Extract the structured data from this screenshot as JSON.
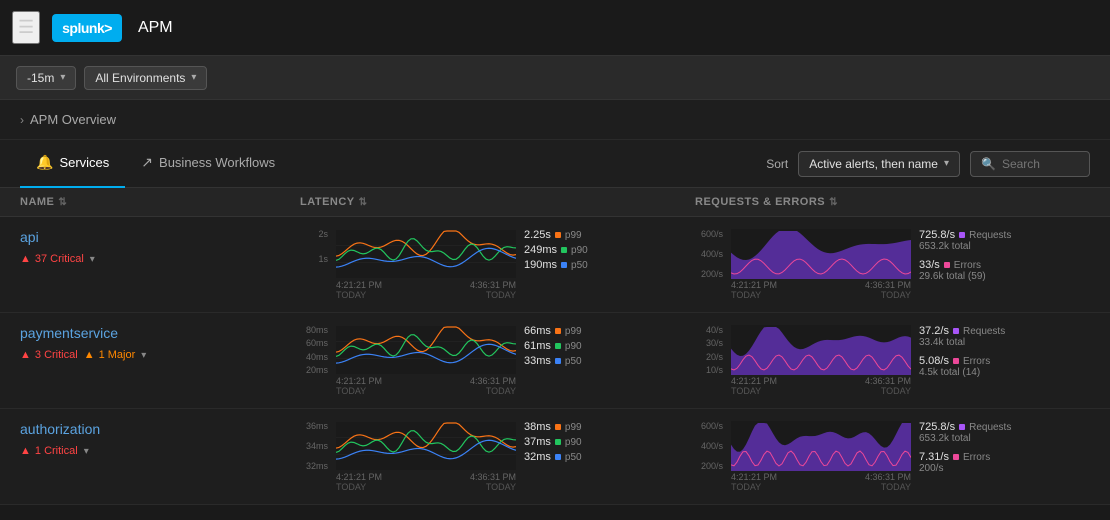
{
  "header": {
    "app_title": "APM",
    "logo_text": "splunk>"
  },
  "toolbar": {
    "time_picker": "-15m",
    "environment": "All Environments"
  },
  "breadcrumb": {
    "label": "APM Overview"
  },
  "tabs": [
    {
      "id": "services",
      "label": "Services",
      "active": true,
      "icon": "🔔"
    },
    {
      "id": "business-workflows",
      "label": "Business Workflows",
      "active": false,
      "icon": "↗"
    }
  ],
  "sort": {
    "label": "Sort",
    "value": "Active alerts, then name"
  },
  "search": {
    "placeholder": "Search"
  },
  "table": {
    "columns": [
      "NAME",
      "LATENCY",
      "REQUESTS & ERRORS"
    ],
    "services": [
      {
        "name": "api",
        "alerts": [
          {
            "type": "critical",
            "count": "37",
            "label": "Critical"
          }
        ],
        "latency": {
          "p99": "2.25s",
          "p90": "249ms",
          "p50": "190ms",
          "chart_time_start": "4:21:21 PM",
          "chart_time_end": "4:36:31 PM",
          "y_max": "2s",
          "y_mid": "1s"
        },
        "requests": {
          "rate": "725.8/s",
          "rate_label": "Requests",
          "total": "653.2k total",
          "errors_rate": "33/s",
          "errors_label": "Errors",
          "errors_total": "29.6k total (59)",
          "chart_time_start": "4:21:21 PM",
          "chart_time_end": "4:36:31 PM",
          "y_max": "600/s",
          "y_vals": [
            "600/s",
            "400/s",
            "200/s"
          ]
        }
      },
      {
        "name": "paymentservice",
        "alerts": [
          {
            "type": "critical",
            "count": "3",
            "label": "Critical"
          },
          {
            "type": "major",
            "count": "1",
            "label": "Major"
          }
        ],
        "latency": {
          "p99": "66ms",
          "p90": "61ms",
          "p50": "33ms",
          "chart_time_start": "4:21:21 PM",
          "chart_time_end": "4:36:31 PM",
          "y_max": "80ms",
          "y_vals": [
            "80ms",
            "60ms",
            "40ms",
            "20ms"
          ]
        },
        "requests": {
          "rate": "37.2/s",
          "rate_label": "Requests",
          "total": "33.4k total",
          "errors_rate": "5.08/s",
          "errors_label": "Errors",
          "errors_total": "4.5k total (14)",
          "chart_time_start": "4:21:21 PM",
          "chart_time_end": "4:36:31 PM",
          "y_vals": [
            "40/s",
            "30/s",
            "20/s",
            "10/s"
          ]
        }
      },
      {
        "name": "authorization",
        "alerts": [
          {
            "type": "critical",
            "count": "1",
            "label": "Critical"
          }
        ],
        "latency": {
          "p99": "38ms",
          "p90": "37ms",
          "p50": "32ms",
          "y_vals": [
            "36ms",
            "34ms",
            "32ms"
          ]
        },
        "requests": {
          "rate": "725.8/s",
          "rate_label": "Requests",
          "total": "653.2k total",
          "errors_rate": "7.31/s",
          "errors_label": "Errors",
          "errors_total": "200/s",
          "y_vals": [
            "600/s",
            "400/s",
            "200/s"
          ]
        }
      }
    ]
  },
  "colors": {
    "purple": "#a855f7",
    "orange": "#f97316",
    "green": "#22c55e",
    "blue": "#3b82f6",
    "pink": "#ec4899",
    "accent": "#00adef",
    "critical": "#ff4444",
    "major": "#ff8800"
  }
}
